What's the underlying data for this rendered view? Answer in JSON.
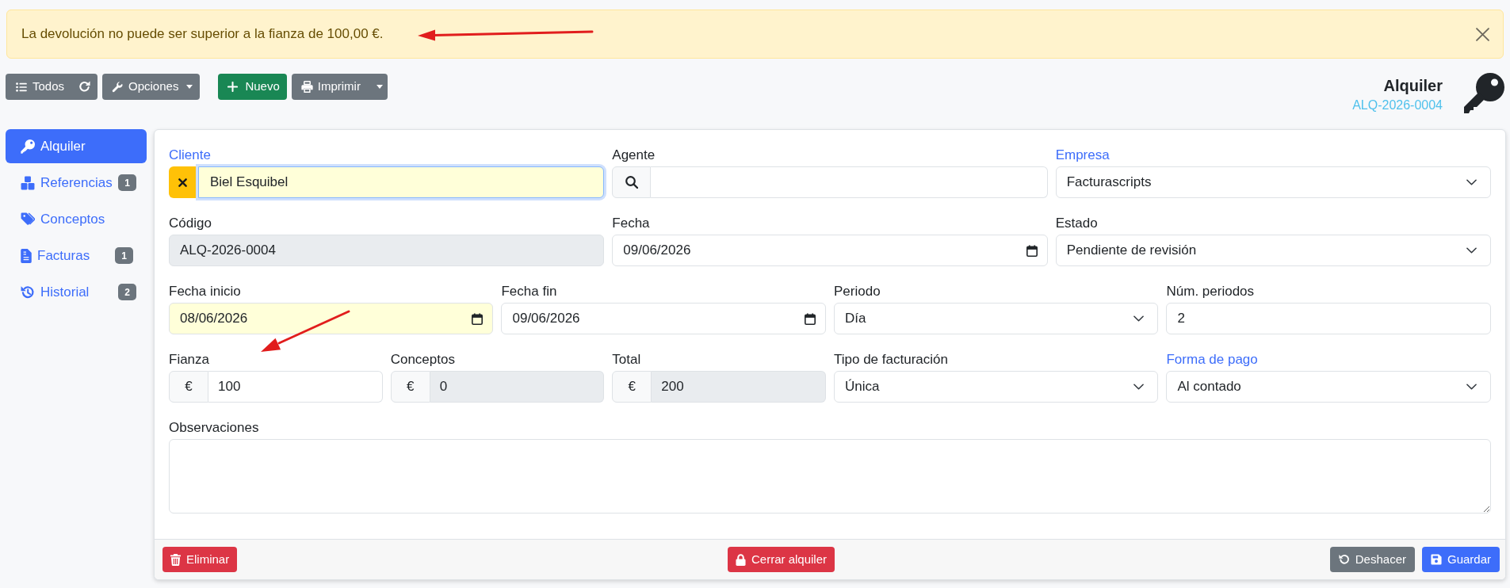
{
  "alert": {
    "message": "La devolución no puede ser superior a la fianza de 100,00 €."
  },
  "toolbar": {
    "list_button": "Todos",
    "options_button": "Opciones",
    "new_button": "Nuevo",
    "print_button": "Imprimir"
  },
  "header": {
    "title": "Alquiler",
    "code": "ALQ-2026-0004"
  },
  "sidebar": {
    "items": [
      {
        "label": "Alquiler",
        "selected": true
      },
      {
        "label": "Referencias",
        "badge": "1",
        "selected": false
      },
      {
        "label": "Conceptos",
        "selected": false
      },
      {
        "label": "Facturas",
        "badge": "1",
        "selected": false
      },
      {
        "label": "Historial",
        "badge": "2",
        "selected": false
      }
    ]
  },
  "form": {
    "rows": [
      {
        "fields": [
          {
            "kind": "autocomplete",
            "label": "Cliente",
            "value": "Biel Esquibel",
            "linked": true,
            "focused": true,
            "highlighted": true,
            "disabled": false
          },
          {
            "kind": "search",
            "label": "Agente",
            "linked": false,
            "focused": false,
            "highlighted": false,
            "disabled": false
          },
          {
            "kind": "select",
            "label": "Empresa",
            "value": "Facturascripts",
            "linked": true,
            "focused": false,
            "highlighted": false,
            "disabled": false
          }
        ]
      },
      {
        "fields": [
          {
            "kind": "text",
            "label": "Código",
            "value": "ALQ-2026-0004",
            "linked": false,
            "focused": false,
            "highlighted": false,
            "disabled": true
          },
          {
            "kind": "date",
            "label": "Fecha",
            "value": "09/06/2026",
            "linked": false,
            "focused": false,
            "highlighted": false,
            "disabled": false
          },
          {
            "kind": "select",
            "label": "Estado",
            "value": "Pendiente de revisión",
            "linked": false,
            "focused": false,
            "highlighted": false,
            "disabled": false
          }
        ]
      },
      {
        "fields": [
          {
            "kind": "date",
            "label": "Fecha inicio",
            "value": "08/06/2026",
            "linked": false,
            "focused": false,
            "highlighted": true,
            "disabled": false
          },
          {
            "kind": "date",
            "label": "Fecha fin",
            "value": "09/06/2026",
            "linked": false,
            "focused": false,
            "highlighted": false,
            "disabled": false
          },
          {
            "kind": "select",
            "label": "Periodo",
            "value": "Día",
            "linked": false,
            "focused": false,
            "highlighted": false,
            "disabled": false
          },
          {
            "kind": "text",
            "label": "Núm. periodos",
            "value": "2",
            "linked": false,
            "focused": false,
            "highlighted": false,
            "disabled": false
          }
        ]
      },
      {
        "fields": [
          {
            "kind": "currency",
            "label": "Fianza",
            "prefix": "€",
            "value": "100",
            "linked": false,
            "focused": false,
            "highlighted": false,
            "disabled": false
          },
          {
            "kind": "currency",
            "label": "Conceptos",
            "prefix": "€",
            "value": "0",
            "linked": false,
            "focused": false,
            "highlighted": false,
            "disabled": true
          },
          {
            "kind": "currency",
            "label": "Total",
            "prefix": "€",
            "value": "200",
            "linked": false,
            "focused": false,
            "highlighted": false,
            "disabled": true
          },
          {
            "kind": "select",
            "label": "Tipo de facturación",
            "value": "Única",
            "linked": false,
            "focused": false,
            "highlighted": false,
            "disabled": false
          },
          {
            "kind": "select",
            "label": "Forma de pago",
            "value": "Al contado",
            "linked": true,
            "focused": false,
            "highlighted": false,
            "disabled": false
          }
        ]
      },
      {
        "fields": [
          {
            "kind": "textarea",
            "label": "Observaciones",
            "linked": false,
            "focused": false,
            "highlighted": false,
            "disabled": false
          }
        ]
      }
    ]
  },
  "footer": {
    "delete_button": "Eliminar",
    "close_button": "Cerrar alquiler",
    "undo_button": "Deshacer",
    "save_button": "Guardar"
  }
}
